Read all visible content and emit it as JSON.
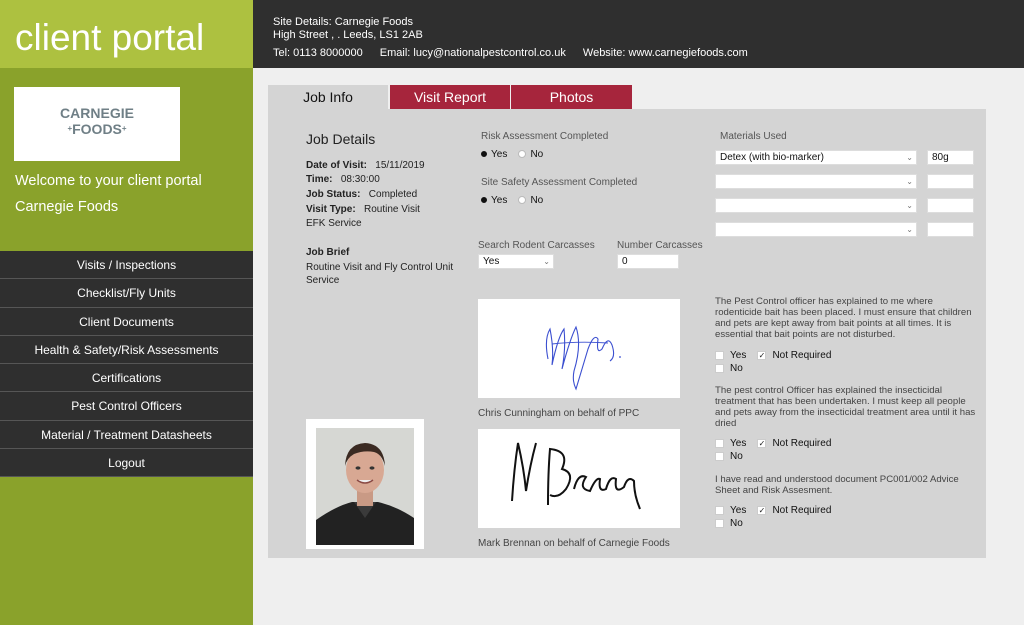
{
  "brand": "client portal",
  "logo": {
    "line1": "CARNEGIE",
    "line2": "FOODS",
    "star": "+"
  },
  "welcome": "Welcome to your client portal",
  "client_name": "Carnegie Foods",
  "nav": [
    "Visits / Inspections",
    "Checklist/Fly Units",
    "Client Documents",
    "Health & Safety/Risk Assessments",
    "Certifications",
    "Pest Control Officers",
    "Material / Treatment Datasheets",
    "Logout"
  ],
  "header": {
    "site_details": "Site Details: Carnegie Foods",
    "address": "High Street , .  Leeds, LS1 2AB",
    "tel": "Tel:  0113 8000000",
    "email": "Email:  lucy@nationalpestcontrol.co.uk",
    "website": "Website:  www.carnegiefoods.com"
  },
  "tabs": {
    "job_info": "Job Info",
    "visit_report": "Visit Report",
    "photos": "Photos"
  },
  "job": {
    "heading": "Job Details",
    "date_label": "Date of Visit:",
    "date_value": "15/11/2019",
    "time_label": "Time:",
    "time_value": "08:30:00",
    "status_label": "Job Status:",
    "status_value": "Completed",
    "visit_type_label": "Visit Type:",
    "visit_type_value": "Routine Visit",
    "service": "EFK Service",
    "brief_label": "Job Brief",
    "brief_line1": "Routine Visit and Fly Control Unit",
    "brief_line2": "Service"
  },
  "risk": {
    "label": "Risk Assessment Completed",
    "yes": "Yes",
    "no": "No",
    "selected": "Yes"
  },
  "site_safety": {
    "label": "Site Safety Assessment Completed",
    "yes": "Yes",
    "no": "No",
    "selected": "Yes"
  },
  "rodent": {
    "label": "Search Rodent Carcasses",
    "value": "Yes",
    "count_label": "Number Carcasses",
    "count_value": "0"
  },
  "signatures": {
    "ppc": "Chris Cunningham on behalf of PPC",
    "client": "Mark Brennan on behalf of Carnegie Foods"
  },
  "materials": {
    "label": "Materials Used",
    "rows": [
      {
        "material": "Detex (with bio-marker)",
        "qty": "80g"
      },
      {
        "material": "",
        "qty": ""
      },
      {
        "material": "",
        "qty": ""
      },
      {
        "material": "",
        "qty": ""
      }
    ]
  },
  "statements": [
    {
      "text": "The Pest Control officer has explained to me where rodenticide bait has been placed. I must ensure that children and pets are kept away from bait points at all times. It is essential that bait points are not disturbed.",
      "yes": "Yes",
      "not_required": "Not Required",
      "no": "No",
      "checked": "Not Required"
    },
    {
      "text": "The pest control Officer has explained the insecticidal treatment that has been undertaken. I must keep all people and pets away from the insecticidal treatment area until it has dried",
      "yes": "Yes",
      "not_required": "Not Required",
      "no": "No",
      "checked": "Not Required"
    },
    {
      "text": "I have read and understood document PC001/002 Advice Sheet and Risk Assesment.",
      "yes": "Yes",
      "not_required": "Not Required",
      "no": "No",
      "checked": "Not Required"
    }
  ],
  "colors": {
    "sidebar": "#8aa22b",
    "brand": "#adc140",
    "dark": "#2f2f2f",
    "tab_red": "#a6253c",
    "panel": "#d4d4d4"
  }
}
